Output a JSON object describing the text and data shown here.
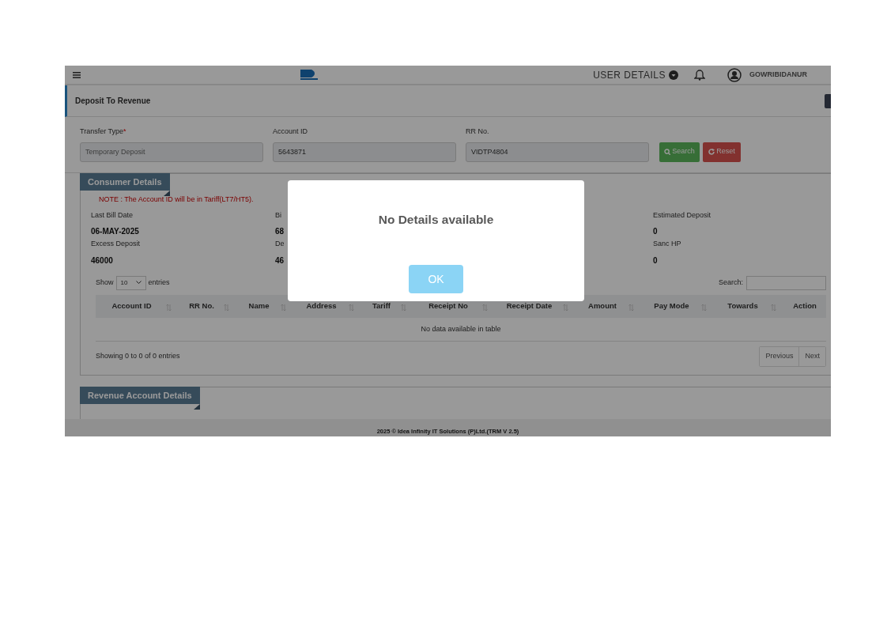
{
  "header": {
    "user_details": "USER DETAILS",
    "location": "GOWRIBIDANUR"
  },
  "page_title": "Deposit To Revenue",
  "form": {
    "fields": [
      {
        "label": "Transfer Type",
        "required_mark": "*",
        "placeholder": "Temporary Deposit"
      },
      {
        "label": "Account ID",
        "value": "5643871"
      },
      {
        "label": "RR No.",
        "value": "VIDTP4804"
      }
    ],
    "buttons": [
      {
        "label": "Search",
        "kind": "search"
      },
      {
        "label": "Reset",
        "kind": "reset"
      }
    ]
  },
  "consumer_details": {
    "title": "Consumer Details",
    "note": "NOTE : The Account ID will be in Tariff(LT7/HT5).",
    "columns": [
      [
        {
          "label": "Last Bill Date",
          "value": "06-MAY-2025"
        },
        {
          "label": "Excess Deposit",
          "value": "46000"
        }
      ],
      [
        {
          "label": "Bi",
          "value": "68"
        },
        {
          "label": "De",
          "value": "46"
        }
      ],
      [
        {
          "label": "Estimated Deposit",
          "value": "0"
        },
        {
          "label": "Sanc HP",
          "value": "0"
        }
      ]
    ],
    "table": {
      "show_label": "Show",
      "page_size": "10",
      "entries_label": "entries",
      "search_label": "Search:",
      "columns": [
        "Account ID",
        "RR No.",
        "Name",
        "Address",
        "Tariff",
        "Receipt No",
        "Receipt Date",
        "Amount",
        "Pay Mode",
        "Towards",
        "Action"
      ],
      "empty_message": "No data available in table",
      "info": "Showing 0 to 0 of 0 entries",
      "pagination": [
        {
          "label": "Previous",
          "disabled": true
        },
        {
          "label": "Next",
          "disabled": true
        }
      ]
    }
  },
  "revenue_details": {
    "title": "Revenue Account Details"
  },
  "footer": "2025 © Idea Infinity IT Solutions (P)Ltd.(TRM V 2.5)",
  "modal": {
    "title": "No Details available",
    "button": "OK"
  }
}
